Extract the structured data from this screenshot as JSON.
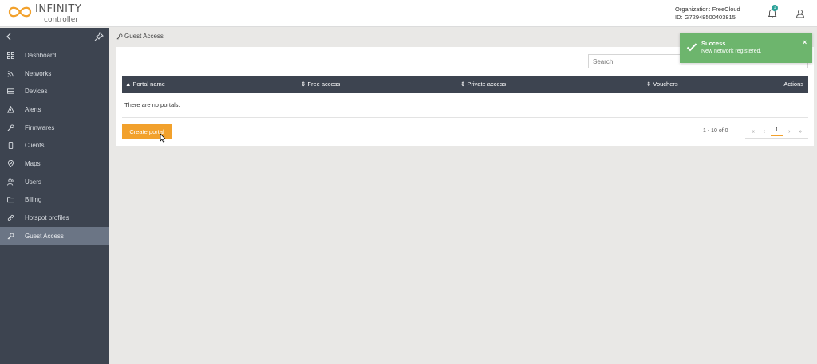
{
  "brand": {
    "name": "INFINITY",
    "subtitle": "controller",
    "accent": "#f2a12c"
  },
  "header": {
    "organization": "Organization: FreeCloud",
    "id": "ID: G72948500403815",
    "notifications_count": "1"
  },
  "sidebar": {
    "items": [
      {
        "label": "Dashboard",
        "icon": "dashboard-icon"
      },
      {
        "label": "Networks",
        "icon": "wifi-icon"
      },
      {
        "label": "Devices",
        "icon": "device-icon"
      },
      {
        "label": "Alerts",
        "icon": "alert-icon"
      },
      {
        "label": "Firmwares",
        "icon": "wrench-icon"
      },
      {
        "label": "Clients",
        "icon": "phone-icon"
      },
      {
        "label": "Maps",
        "icon": "map-pin-icon"
      },
      {
        "label": "Users",
        "icon": "users-icon"
      },
      {
        "label": "Billing",
        "icon": "folder-icon"
      },
      {
        "label": "Hotspot profiles",
        "icon": "link-icon"
      },
      {
        "label": "Guest Access",
        "icon": "key-icon",
        "active": true
      }
    ]
  },
  "page": {
    "breadcrumb": "Guest Access"
  },
  "search": {
    "placeholder": "Search"
  },
  "table": {
    "columns": [
      "▲ Portal name",
      "⇕ Free access",
      "⇕ Private access",
      "⇕ Vouchers",
      "Actions"
    ],
    "empty_text": "There are no portals."
  },
  "actions": {
    "create_label": "Create portal"
  },
  "pagination": {
    "range": "1 - 10 of 0",
    "first": "«",
    "prev": "‹",
    "current": "1",
    "next": "›",
    "last": "»"
  },
  "toast": {
    "title": "Success",
    "message": "New network registered.",
    "close": "×",
    "color": "#6db56d"
  }
}
